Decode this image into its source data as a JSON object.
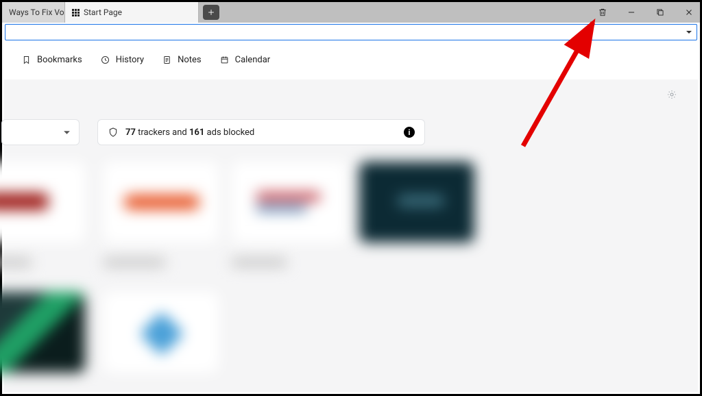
{
  "tabs": {
    "inactive": {
      "title": "Ways To Fix Voic"
    },
    "active": {
      "title": "Start Page"
    }
  },
  "toolbar": {
    "bookmarks": "Bookmarks",
    "history": "History",
    "notes": "Notes",
    "calendar": "Calendar"
  },
  "privacy": {
    "trackers": "77",
    "sep1": " trackers and ",
    "ads": "161",
    "sep2": " ads blocked"
  }
}
